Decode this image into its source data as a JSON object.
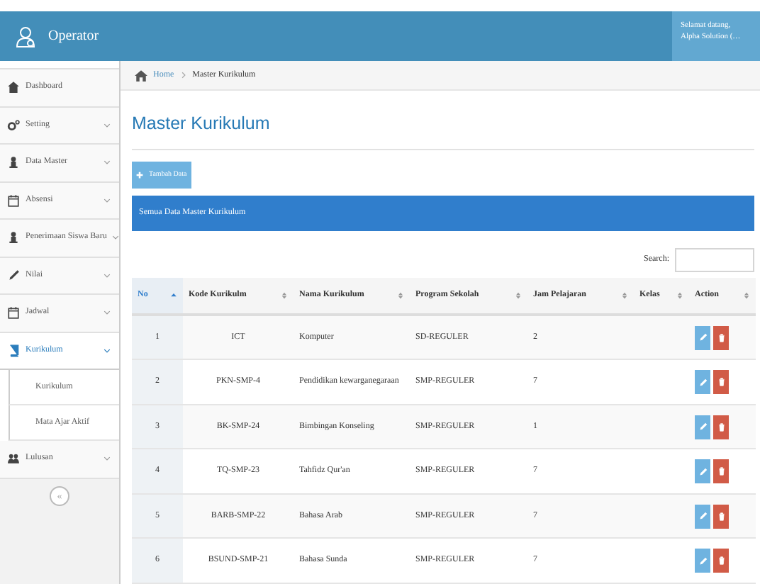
{
  "header": {
    "title": "Operator",
    "user": {
      "greeting": "Selamat datang,",
      "name": "Alpha Solution (…"
    }
  },
  "breadcrumb": [
    {
      "label": "Home",
      "link": true
    },
    {
      "label": "Master Kurikulum",
      "link": false
    }
  ],
  "sidebar": {
    "items": [
      {
        "label": "Dashboard",
        "expandable": false,
        "expanded": false,
        "selected": false
      },
      {
        "label": "Setting",
        "expandable": true,
        "expanded": false,
        "selected": false
      },
      {
        "label": "Data Master",
        "expandable": true,
        "expanded": false,
        "selected": false
      },
      {
        "label": "Absensi",
        "expandable": true,
        "expanded": false,
        "selected": false
      },
      {
        "label": "Penerimaan Siswa Baru",
        "expandable": true,
        "expanded": false,
        "selected": false
      },
      {
        "label": "Nilai",
        "expandable": true,
        "expanded": false,
        "selected": false
      },
      {
        "label": "Jadwal",
        "expandable": true,
        "expanded": false,
        "selected": false
      },
      {
        "label": "Kurikulum",
        "expandable": true,
        "expanded": true,
        "selected": true,
        "children": [
          {
            "label": "Kurikulum",
            "selected": false
          },
          {
            "label": "Mata Ajar Aktif",
            "selected": false
          }
        ]
      },
      {
        "label": "Lulusan",
        "expandable": true,
        "expanded": false,
        "selected": false
      }
    ],
    "collapse": "«"
  },
  "page": {
    "title": "Master Kurikulum",
    "add_button": "Tambah Data",
    "panel_title": "Semua Data Master Kurikulum",
    "search_label": "Search:"
  },
  "table": {
    "columns": [
      {
        "label": "No",
        "sorted": true
      },
      {
        "label": "Kode Kurikulm",
        "sorted": false
      },
      {
        "label": "Nama Kurikulum",
        "sorted": false
      },
      {
        "label": "Program Sekolah",
        "sorted": false
      },
      {
        "label": "Jam Pelajaran",
        "sorted": false
      },
      {
        "label": "Kelas",
        "sorted": false
      },
      {
        "label": "Action",
        "sorted": false
      }
    ],
    "rows": [
      [
        "1",
        "ICT",
        "Komputer",
        "SD-REGULER",
        "2",
        ""
      ],
      [
        "2",
        "PKN-SMP-4",
        "Pendidikan kewarganegaraan",
        "SMP-REGULER",
        "7",
        ""
      ],
      [
        "3",
        "BK-SMP-24",
        "Bimbingan Konseling",
        "SMP-REGULER",
        "1",
        ""
      ],
      [
        "4",
        "TQ-SMP-23",
        "Tahfidz Qur'an",
        "SMP-REGULER",
        "7",
        ""
      ],
      [
        "5",
        "BARB-SMP-22",
        "Bahasa Arab",
        "SMP-REGULER",
        "7",
        ""
      ],
      [
        "6",
        "BSUND-SMP-21",
        "Bahasa Sunda",
        "SMP-REGULER",
        "7",
        ""
      ]
    ]
  }
}
